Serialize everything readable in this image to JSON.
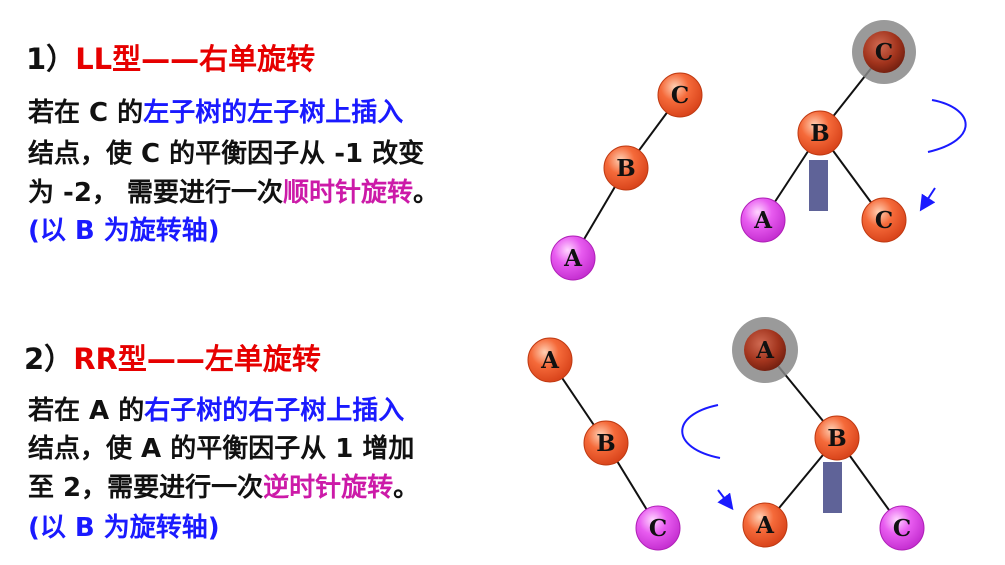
{
  "section1": {
    "number": "1）",
    "title_type": "LL型——右单旋转",
    "lines": [
      [
        {
          "text": "若在 C 的",
          "style": ""
        },
        {
          "text": "左子树的左子树上插入",
          "style": "blue"
        }
      ],
      [
        {
          "text": "结点，使 C 的平衡因子从 -1 改变",
          "style": ""
        }
      ],
      [
        {
          "text": "为 -2， 需要进行一次",
          "style": ""
        },
        {
          "text": "顺时针旋转",
          "style": "mag"
        },
        {
          "text": "。",
          "style": ""
        }
      ],
      [
        {
          "text": "(以 B 为旋转轴)",
          "style": "pin"
        }
      ]
    ]
  },
  "section2": {
    "number": "2）",
    "title_type": "RR型——左单旋转",
    "lines": [
      [
        {
          "text": "若在 A 的",
          "style": ""
        },
        {
          "text": "右子树的右子树上插入",
          "style": "blue"
        }
      ],
      [
        {
          "text": "结点，使 A 的平衡因子从 1 增加",
          "style": ""
        }
      ],
      [
        {
          "text": "至 2，需要进行一次",
          "style": ""
        },
        {
          "text": "逆时针旋转",
          "style": "mag"
        },
        {
          "text": "。",
          "style": ""
        }
      ],
      [
        {
          "text": "(以 B 为旋转轴)",
          "style": "pin"
        }
      ]
    ]
  },
  "trees": {
    "ll_before": {
      "top": "C",
      "middle": "B",
      "bottom": "A"
    },
    "ll_after": {
      "root": "C",
      "pivot": "B",
      "left": "A",
      "right": "C"
    },
    "rr_before": {
      "top": "A",
      "middle": "B",
      "bottom": "C"
    },
    "rr_after": {
      "root": "A",
      "pivot": "B",
      "left": "A",
      "right": "C"
    }
  },
  "colors": {
    "title_red": "#e60000",
    "emphasis_blue": "#1a1aff",
    "emphasis_magenta": "#cc1aa8",
    "node_orange": "#f25a28",
    "node_magenta": "#e040e8",
    "halo_gray": "#8a8a8a",
    "axis_bar": "#5f6398",
    "arrow_blue": "#1a1aff"
  }
}
